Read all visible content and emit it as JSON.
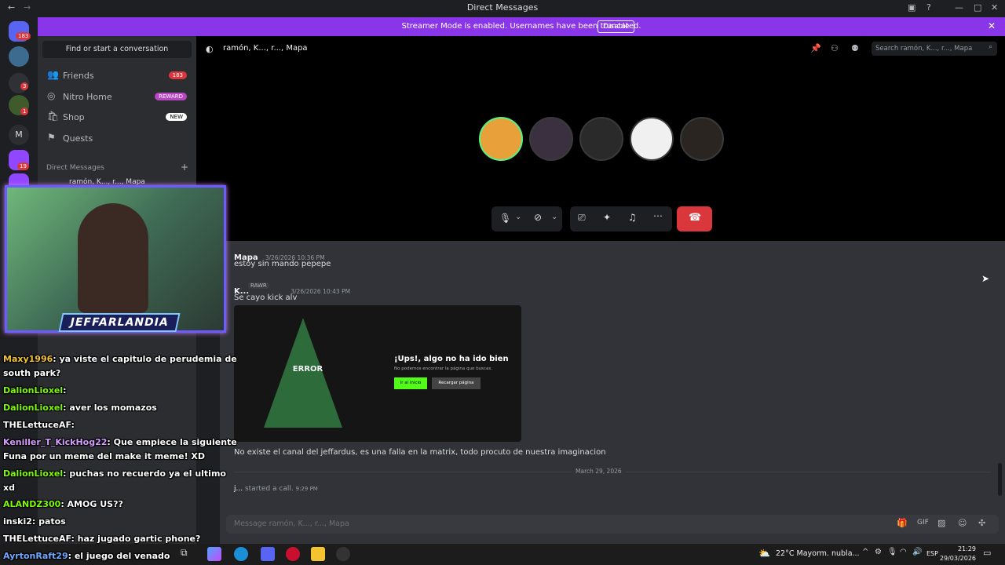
{
  "window": {
    "title": "Direct Messages"
  },
  "banner": {
    "message": "Streamer Mode is enabled. Usernames have been truncated.",
    "disable_label": "Disable"
  },
  "rail": {
    "badges": [
      "183",
      "3",
      "1",
      "19"
    ],
    "letter": "M"
  },
  "sidebar": {
    "find_label": "Find or start a conversation",
    "nav": [
      {
        "label": "Friends",
        "pill": "183",
        "icon": "friends-icon"
      },
      {
        "label": "Nitro Home",
        "pill": "REWARD",
        "icon": "nitro-icon"
      },
      {
        "label": "Shop",
        "pill": "NEW",
        "icon": "shop-icon"
      },
      {
        "label": "Quests",
        "pill": "",
        "icon": "quests-icon"
      }
    ],
    "dm_header": "Direct Messages",
    "dm_first": "ramón, K..., r..., Mapa"
  },
  "call": {
    "header_title": "ramón, K..., r..., Mapa",
    "search_placeholder": "Search ramón, K..., r..., Mapa"
  },
  "messages": [
    {
      "author": "Mapa",
      "time": "3/26/2026 10:36 PM",
      "text": "estoy sin mando pepepe"
    },
    {
      "author": "K...",
      "tag": "RAWR",
      "time": "3/26/2026 10:43 PM",
      "text": "Se cayo kick alv"
    },
    {
      "text": "No existe el canal del jeffardus, es una falla en la matrix, todo procuto de nuestra imaginacion"
    }
  ],
  "embed": {
    "heading": "¡Ups!, algo no ha ido bien",
    "sub": "No podemos encontrar la página que buscas.",
    "btn_primary": "Ir al inicio",
    "btn_secondary": "Recargar página",
    "sign_text": "ERROR"
  },
  "divider_date": "March 29, 2026",
  "call_event": {
    "author": "j...",
    "text": "started a call.",
    "time": "9:29 PM"
  },
  "composer_placeholder": "Message ramón, K..., r..., Mapa",
  "overlay": {
    "logo": "JEFFARLANDIA",
    "chat": [
      {
        "user": "Maxy1996",
        "color": "#f4c430",
        "text": ": ya viste el capitulo de perudemia de"
      },
      {
        "user": "",
        "color": "#fff",
        "text": "south park?"
      },
      {
        "user": "DalionLioxel",
        "color": "#7cfc00",
        "text": ":"
      },
      {
        "user": "DalionLioxel",
        "color": "#7cfc00",
        "text": ": aver los momazos"
      },
      {
        "user": "THELettuceAF",
        "color": "#ffffff",
        "text": ":"
      },
      {
        "user": "Keniller_T_KickHog22",
        "color": "#d59bff",
        "text": ": Que empiece la siguiente"
      },
      {
        "user": "",
        "color": "#fff",
        "text": "Funa por un meme del make it meme! XD"
      },
      {
        "user": "DalionLioxel",
        "color": "#7cfc00",
        "text": ": puchas no recuerdo ya el ultimo"
      },
      {
        "user": "",
        "color": "#fff",
        "text": "xd"
      },
      {
        "user": "ALANDZ300",
        "color": "#7cfc00",
        "text": ": AMOG US??"
      },
      {
        "user": "inski2",
        "color": "#ffffff",
        "text": ": patos"
      },
      {
        "user": "THELettuceAF",
        "color": "#ffffff",
        "text": ": haz jugado gartic phone?"
      },
      {
        "user": "AyrtonRaft29",
        "color": "#6fa8ff",
        "text": ": el juego del venado"
      }
    ]
  },
  "taskbar": {
    "weather": "22°C  Mayorm. nubla...",
    "lang": "ESP",
    "time": "21:29",
    "date": "29/03/2026"
  },
  "colors": {
    "accent": "#5865f2",
    "banner": "#8936e8",
    "hangup": "#da373c",
    "green": "#57f287"
  }
}
